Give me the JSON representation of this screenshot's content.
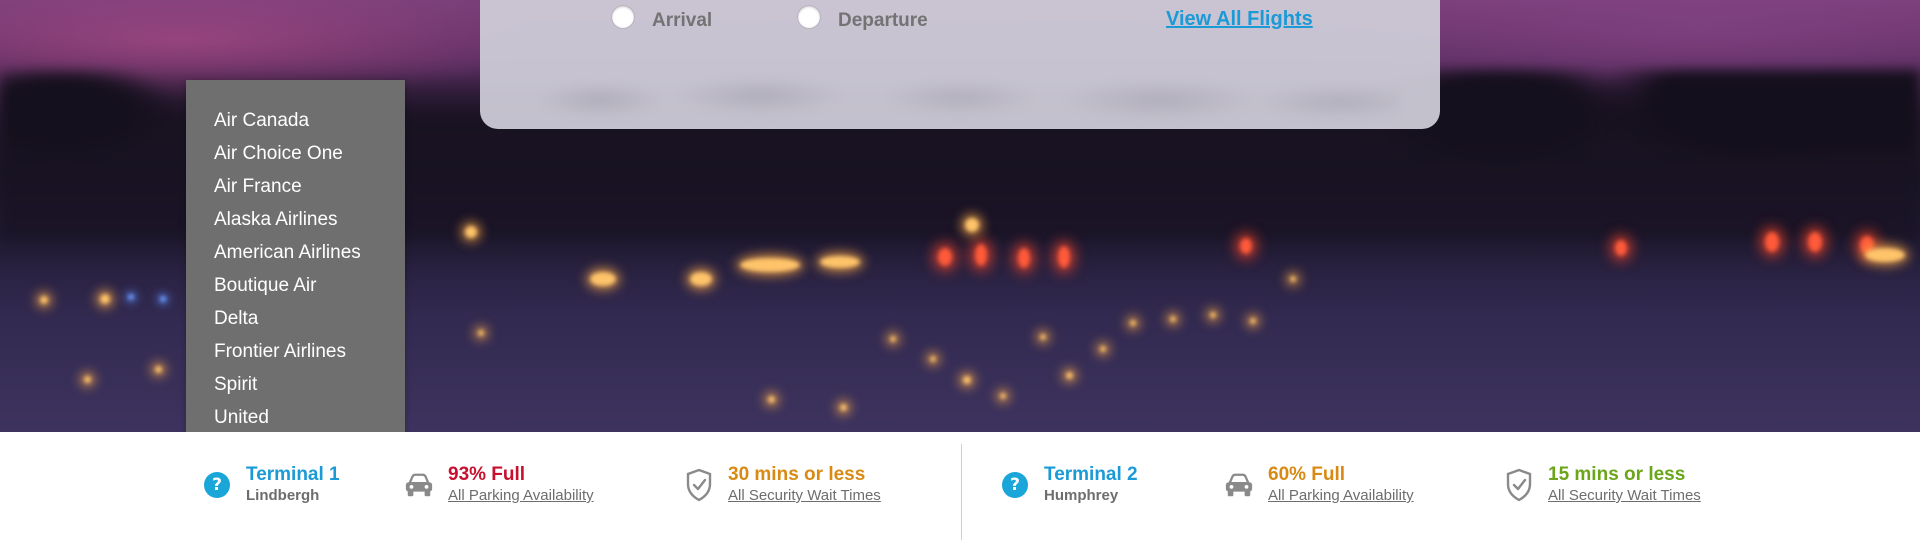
{
  "search": {
    "flight_type_options": [
      {
        "label": "Arrival",
        "selected": false
      },
      {
        "label": "Departure",
        "selected": false
      }
    ],
    "view_all_link": "View All Flights"
  },
  "airline_dropdown": {
    "items": [
      "Air Canada",
      "Air Choice One",
      "Air France",
      "Alaska Airlines",
      "American Airlines",
      "Boutique Air",
      "Delta",
      "Frontier Airlines",
      "Spirit",
      "United"
    ]
  },
  "terminals": [
    {
      "name": "Terminal 1",
      "subtitle": "Lindbergh",
      "parking_status": "93% Full",
      "parking_status_color": "#c8102e",
      "parking_link": "All Parking Availability",
      "security_status": "30 mins or less",
      "security_status_color": "#d88a12",
      "security_link": "All Security Wait Times"
    },
    {
      "name": "Terminal 2",
      "subtitle": "Humphrey",
      "parking_status": "60% Full",
      "parking_status_color": "#d88a12",
      "parking_link": "All Parking Availability",
      "security_status": "15 mins or less",
      "security_status_color": "#6aa51a",
      "security_link": "All Security Wait Times"
    }
  ],
  "icons": {
    "terminal_info": "help-circle-icon",
    "parking": "car-icon",
    "security": "shield-check-icon"
  },
  "colors": {
    "accent_blue": "#1a9ad6",
    "dropdown_bg": "#6f6f6f",
    "card_bg": "#cecbd8"
  }
}
